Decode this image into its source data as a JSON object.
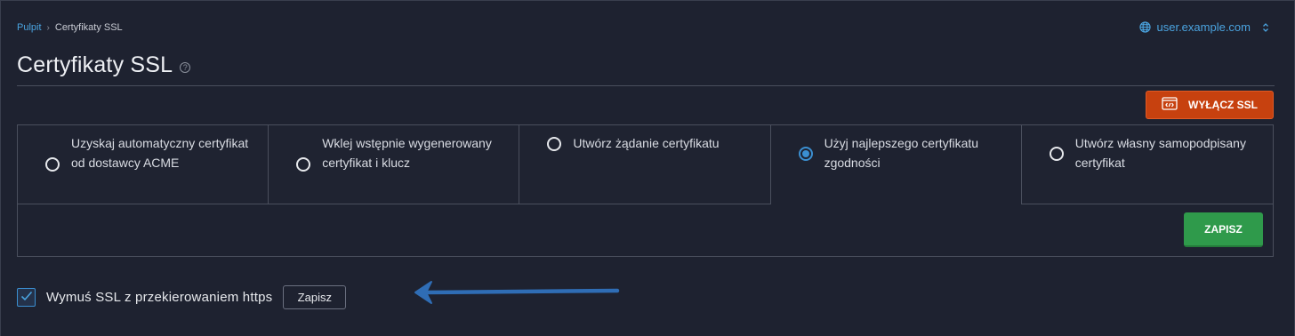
{
  "breadcrumb": {
    "home": "Pulpit",
    "current": "Certyfikaty SSL"
  },
  "domain": {
    "value": "user.example.com",
    "icon": "globe-icon"
  },
  "page": {
    "title": "Certyfikaty SSL",
    "help_icon": "help-icon"
  },
  "disable_ssl_button": {
    "label": "WYŁĄCZ SSL",
    "icon": "certificate-icon",
    "color": "#c7410f"
  },
  "tabs": [
    {
      "label": "Uzyskaj automatyczny certyfikat od dostawcy ACME",
      "selected": false
    },
    {
      "label": "Wklej wstępnie wygenerowany certyfikat i klucz",
      "selected": false
    },
    {
      "label": "Utwórz żądanie certyfikatu",
      "selected": false
    },
    {
      "label": "Użyj najlepszego certyfikatu zgodności",
      "selected": true
    },
    {
      "label": "Utwórz własny samopodpisany certyfikat",
      "selected": false
    }
  ],
  "save_button": {
    "label": "ZAPISZ",
    "color": "#2f9a4b"
  },
  "force_https": {
    "label": "Wymuś SSL z przekierowaniem https",
    "checked": true,
    "save_label": "Zapisz"
  },
  "annotation": {
    "arrow_color": "#2f6db5"
  },
  "colors": {
    "accent": "#3b8fd1",
    "background": "#1e2230"
  }
}
